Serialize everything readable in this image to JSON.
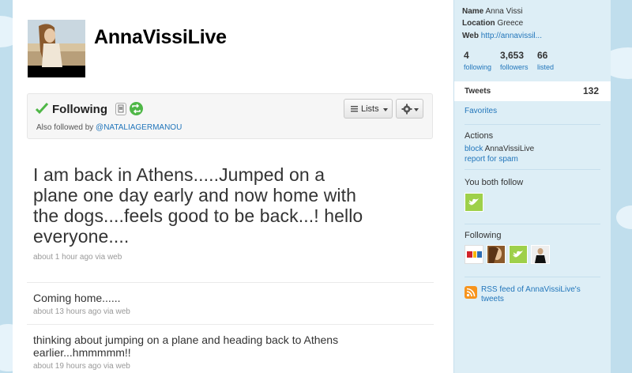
{
  "profile": {
    "screen_name": "AnnaVissiLive"
  },
  "follow_box": {
    "status_label": "Following",
    "also_followed_prefix": "Also followed by ",
    "also_followed_user": "@NATALIAGERMANOU",
    "lists_label": "Lists"
  },
  "tweets": [
    {
      "text": "I am back in Athens.....Jumped on a plane one day early and now home with the dogs....feels good to be back...! hello everyone....",
      "meta": "about 1 hour ago via web"
    },
    {
      "text": "Coming home......",
      "meta": "about 13 hours ago via web"
    },
    {
      "text": "thinking about jumping on a plane and heading back to Athens earlier...hmmmmm!!",
      "meta": "about 19 hours ago via web"
    }
  ],
  "sidebar": {
    "name_label": "Name",
    "name_value": "Anna Vissi",
    "location_label": "Location",
    "location_value": "Greece",
    "web_label": "Web",
    "web_value": "http://annavissil...",
    "stats": [
      {
        "num": "4",
        "label": "following"
      },
      {
        "num": "3,653",
        "label": "followers"
      },
      {
        "num": "66",
        "label": "listed"
      }
    ],
    "tweets_tab": {
      "label": "Tweets",
      "count": "132"
    },
    "favorites_label": "Favorites",
    "actions_heading": "Actions",
    "block_link": "block",
    "block_user": "AnnaVissiLive",
    "report_link": "report for spam",
    "you_both_follow_heading": "You both follow",
    "following_heading": "Following",
    "rss_text": "RSS feed of AnnaVissiLive's tweets"
  },
  "colors": {
    "link": "#2276bb",
    "background": "#c0deed",
    "sidebar": "#ddeef6",
    "check": "#4fb747"
  }
}
